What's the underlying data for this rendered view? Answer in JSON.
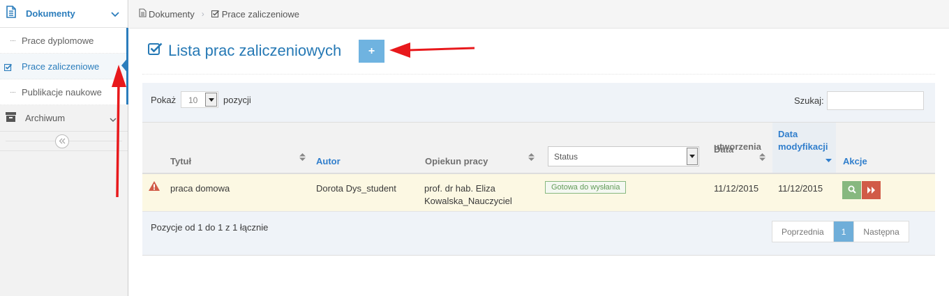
{
  "sidebar": {
    "section": {
      "label": "Dokumenty",
      "icon": "document-icon"
    },
    "items": [
      {
        "label": "Prace dyplomowe",
        "active": false
      },
      {
        "label": "Prace zaliczeniowe",
        "active": true
      },
      {
        "label": "Publikacje naukowe",
        "active": false
      }
    ],
    "archive": {
      "label": "Archiwum",
      "icon": "archive-icon"
    },
    "collapse_icon": "double-chevron-left-icon"
  },
  "breadcrumb": {
    "items": [
      {
        "label": "Dokumenty",
        "icon": "file-icon"
      },
      {
        "label": "Prace zaliczeniowe",
        "icon": "checkbox-icon"
      }
    ]
  },
  "page": {
    "title": "Lista prac zaliczeniowych",
    "add_button_label": "+"
  },
  "table": {
    "length_label_prefix": "Pokaż",
    "length_value": "10",
    "length_label_suffix": "pozycji",
    "search_label": "Szukaj:",
    "search_value": "",
    "columns": {
      "title": "Tytuł",
      "author": "Autor",
      "supervisor": "Opiekun pracy",
      "status_filter": "Status",
      "created_line1": "Data",
      "created_line2": "utworzenia",
      "modified_line1": "Data",
      "modified_line2": "modyfikacji",
      "actions": "Akcje"
    },
    "rows": [
      {
        "title": "praca domowa",
        "author": "Dorota Dys_student",
        "supervisor_line1": "prof. dr hab. Eliza",
        "supervisor_line2": "Kowalska_Nauczyciel",
        "status": "Gotowa do wysłania",
        "created": "11/12/2015",
        "modified": "11/12/2015"
      }
    ],
    "info": "Pozycje od 1 do 1 z 1 łącznie",
    "pagination": {
      "prev": "Poprzednia",
      "current": "1",
      "next": "Następna"
    }
  },
  "colors": {
    "accent": "#2679b5",
    "warning_row": "#fcf8e3",
    "success": "#87b87f",
    "danger": "#d15b47",
    "annotation_arrow": "#e8191c"
  }
}
